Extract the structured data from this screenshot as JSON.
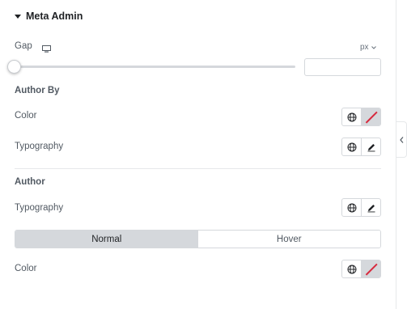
{
  "section": {
    "title": "Meta Admin"
  },
  "gap": {
    "label": "Gap",
    "unit": "px",
    "value": "",
    "slider_fraction": 0
  },
  "author_by": {
    "heading": "Author By",
    "color_label": "Color",
    "typography_label": "Typography"
  },
  "author": {
    "heading": "Author",
    "typography_label": "Typography",
    "tabs": [
      "Normal",
      "Hover"
    ],
    "active_tab": "Normal",
    "color_label": "Color"
  },
  "colors": {
    "text": "#1f2124",
    "label": "#515962",
    "border": "#d5d8dc",
    "no_color_slash": "#d72b3f"
  },
  "icons": {
    "caret": "caret-down-icon",
    "responsive": "desktop-icon",
    "unit_menu": "chevron-down-icon",
    "global": "globe-icon",
    "edit": "pencil-icon",
    "collapse": "chevron-left-icon"
  }
}
